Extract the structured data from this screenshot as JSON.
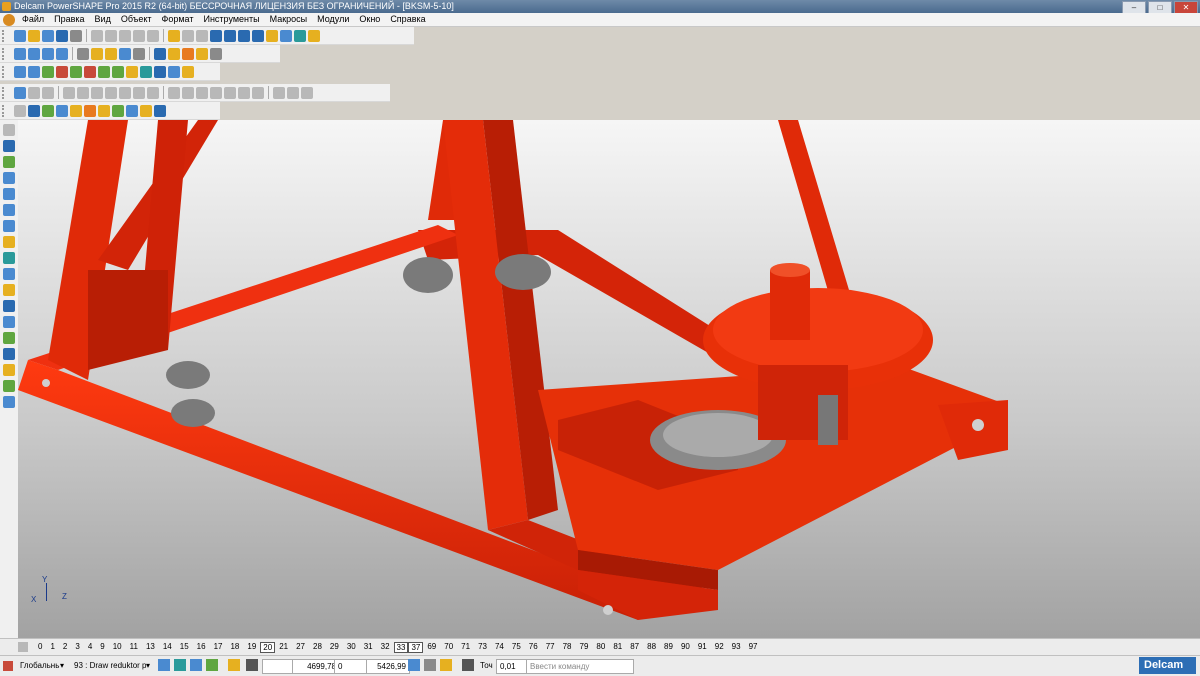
{
  "window": {
    "title": "Delcam PowerSHAPE Pro 2015 R2 (64-bit) БЕССРОЧНАЯ ЛИЦЕНЗИЯ БЕЗ ОГРАНИЧЕНИЙ - [BKSM-5-10]",
    "minimize": "–",
    "restore": "□",
    "close": "✕"
  },
  "menu": [
    "Файл",
    "Правка",
    "Вид",
    "Объект",
    "Формат",
    "Инструменты",
    "Макросы",
    "Модули",
    "Окно",
    "Справка"
  ],
  "axis": {
    "x": "X",
    "y": "Y",
    "z": "Z"
  },
  "levels": [
    "0",
    "1",
    "2",
    "3",
    "4",
    "9",
    "10",
    "11",
    "13",
    "14",
    "15",
    "16",
    "17",
    "18",
    "19",
    "20",
    "21",
    "27",
    "28",
    "29",
    "30",
    "31",
    "32",
    "33",
    "37",
    "69",
    "70",
    "71",
    "73",
    "74",
    "75",
    "76",
    "77",
    "78",
    "79",
    "80",
    "81",
    "87",
    "88",
    "89",
    "90",
    "91",
    "92",
    "93",
    "97"
  ],
  "active_levels": [
    "20",
    "33",
    "37"
  ],
  "status": {
    "workplane": "Глобальнь",
    "draw_mode": "93 : Draw reduktor р",
    "x": "4699,78",
    "y": "0",
    "z": "5426,99",
    "tol_label": "Точ",
    "tol_value": "0,01",
    "command_placeholder": "Ввести команду"
  },
  "logo_text": "Delcam",
  "colors": {
    "model_red": "#e82a08",
    "model_dark_red": "#b01c04",
    "gear_gray": "#8a8a8a"
  }
}
